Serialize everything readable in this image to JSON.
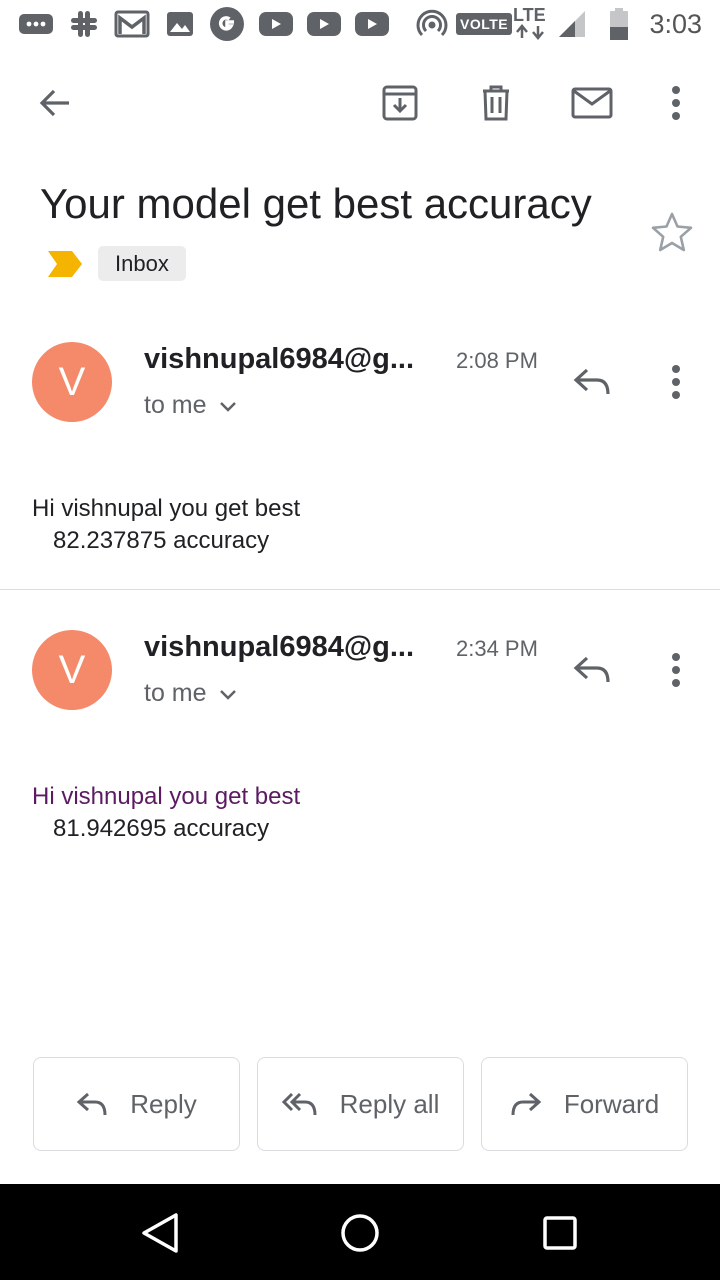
{
  "status_bar": {
    "time": "3:03",
    "volte": "VOLTE",
    "lte": "LTE",
    "icons": [
      "more-notifications-icon",
      "slack-icon",
      "gmail-icon",
      "photos-icon",
      "google-icon",
      "youtube-icon",
      "youtube-icon",
      "youtube-icon",
      "hotspot-icon",
      "signal-icon",
      "battery-icon"
    ]
  },
  "toolbar": {
    "back": "back-arrow-icon",
    "archive": "archive-icon",
    "delete": "delete-icon",
    "mark_unread": "mail-icon",
    "more": "more-vert-icon"
  },
  "subject": "Your model get best accuracy",
  "label": "Inbox",
  "messages": [
    {
      "avatar_letter": "V",
      "sender": "vishnupal6984@g...",
      "time": "2:08 PM",
      "recipient": "to me",
      "body_line1": "Hi vishnupal you get best",
      "body_line2": "82.237875 accuracy",
      "line1_color": "#202124"
    },
    {
      "avatar_letter": "V",
      "sender": "vishnupal6984@g...",
      "time": "2:34 PM",
      "recipient": "to me",
      "body_line1": "Hi vishnupal you get best",
      "body_line2": "81.942695 accuracy",
      "line1_color": "#5b1a62"
    }
  ],
  "actions": {
    "reply": "Reply",
    "reply_all": "Reply all",
    "forward": "Forward"
  },
  "colors": {
    "avatar": "#f48a6a",
    "importance": "#f5b400"
  }
}
